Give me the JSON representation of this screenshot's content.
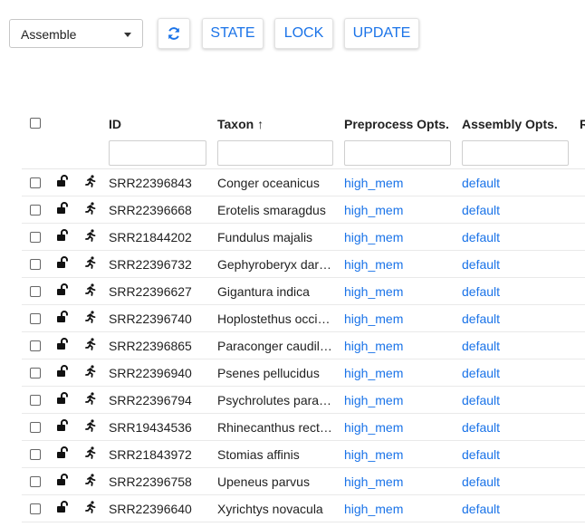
{
  "toolbar": {
    "select_value": "Assemble",
    "refresh_icon": "refresh-icon",
    "state_label": "STATE",
    "lock_label": "LOCK",
    "update_label": "UPDATE"
  },
  "table": {
    "columns": {
      "id": "ID",
      "taxon": "Taxon ↑",
      "preprocess": "Preprocess Opts.",
      "assembly": "Assembly Opts.",
      "more": "R"
    },
    "icons": {
      "lock": "unlock-icon",
      "run": "running-person-icon"
    },
    "colors": {
      "link": "#1a73e8"
    },
    "rows": [
      {
        "id": "SRR22396843",
        "taxon": "Conger oceanicus",
        "preprocess": "high_mem",
        "assembly": "default"
      },
      {
        "id": "SRR22396668",
        "taxon": "Erotelis smaragdus",
        "preprocess": "high_mem",
        "assembly": "default"
      },
      {
        "id": "SRR21844202",
        "taxon": "Fundulus majalis",
        "preprocess": "high_mem",
        "assembly": "default"
      },
      {
        "id": "SRR22396732",
        "taxon": "Gephyroberyx dar…",
        "preprocess": "high_mem",
        "assembly": "default"
      },
      {
        "id": "SRR22396627",
        "taxon": "Gigantura indica",
        "preprocess": "high_mem",
        "assembly": "default"
      },
      {
        "id": "SRR22396740",
        "taxon": "Hoplostethus occi…",
        "preprocess": "high_mem",
        "assembly": "default"
      },
      {
        "id": "SRR22396865",
        "taxon": "Paraconger caudil…",
        "preprocess": "high_mem",
        "assembly": "default"
      },
      {
        "id": "SRR22396940",
        "taxon": "Psenes pellucidus",
        "preprocess": "high_mem",
        "assembly": "default"
      },
      {
        "id": "SRR22396794",
        "taxon": "Psychrolutes para…",
        "preprocess": "high_mem",
        "assembly": "default"
      },
      {
        "id": "SRR19434536",
        "taxon": "Rhinecanthus rect…",
        "preprocess": "high_mem",
        "assembly": "default"
      },
      {
        "id": "SRR21843972",
        "taxon": "Stomias affinis",
        "preprocess": "high_mem",
        "assembly": "default"
      },
      {
        "id": "SRR22396758",
        "taxon": "Upeneus parvus",
        "preprocess": "high_mem",
        "assembly": "default"
      },
      {
        "id": "SRR22396640",
        "taxon": "Xyrichtys novacula",
        "preprocess": "high_mem",
        "assembly": "default"
      }
    ]
  }
}
